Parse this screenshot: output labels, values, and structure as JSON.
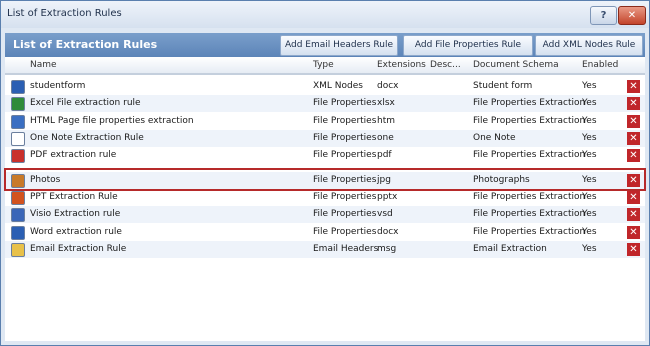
{
  "window": {
    "title": "List of Extraction Rules",
    "help_label": "?",
    "close_label": "✕"
  },
  "header": {
    "title": "List of Extraction Rules",
    "buttons": [
      "Add Email Headers Rule",
      "Add File Properties Rule",
      "Add XML Nodes Rule"
    ]
  },
  "columns": [
    "Name",
    "Type",
    "Extensions",
    "Desc...",
    "Document Schema",
    "Enabled"
  ],
  "rows": [
    {
      "name": "studentform",
      "type": "XML Nodes",
      "ext": "docx",
      "desc": "",
      "schema": "Student form",
      "enabled": "Yes",
      "icon": "word-icon"
    },
    {
      "name": "Excel File extraction rule",
      "type": "File Properties",
      "ext": "xlsx",
      "desc": "",
      "schema": "File Properties Extraction",
      "enabled": "Yes",
      "icon": "excel-icon"
    },
    {
      "name": "HTML Page file properties extraction",
      "type": "File Properties",
      "ext": "htm",
      "desc": "",
      "schema": "File Properties Extraction",
      "enabled": "Yes",
      "icon": "html-icon"
    },
    {
      "name": "One Note Extraction Rule",
      "type": "File Properties",
      "ext": "one",
      "desc": "",
      "schema": "One Note",
      "enabled": "Yes",
      "icon": "document-icon"
    },
    {
      "name": "PDF extraction rule",
      "type": "File Properties",
      "ext": "pdf",
      "desc": "",
      "schema": "File Properties Extraction",
      "enabled": "Yes",
      "icon": "pdf-icon"
    },
    {
      "name": "Photos",
      "type": "File Properties",
      "ext": "jpg",
      "desc": "",
      "schema": "Photographs",
      "enabled": "Yes",
      "icon": "image-icon"
    },
    {
      "name": "PPT Extraction Rule",
      "type": "File Properties",
      "ext": "pptx",
      "desc": "",
      "schema": "File Properties Extraction",
      "enabled": "Yes",
      "icon": "powerpoint-icon"
    },
    {
      "name": "Visio Extraction rule",
      "type": "File Properties",
      "ext": "vsd",
      "desc": "",
      "schema": "File Properties Extraction",
      "enabled": "Yes",
      "icon": "visio-icon"
    },
    {
      "name": "Word extraction rule",
      "type": "File Properties",
      "ext": "docx",
      "desc": "",
      "schema": "File Properties Extraction",
      "enabled": "Yes",
      "icon": "word-icon"
    },
    {
      "name": "Email Extraction Rule",
      "type": "Email Headers",
      "ext": "msg",
      "desc": "",
      "schema": "Email Extraction",
      "enabled": "Yes",
      "icon": "email-icon"
    }
  ],
  "delete_label": "✕",
  "icon_colors": {
    "word-icon": "#2b5fb3",
    "excel-icon": "#2e8b3a",
    "html-icon": "#3b6fc2",
    "document-icon": "#ffffff",
    "pdf-icon": "#c9302c",
    "image-icon": "#c87a2a",
    "powerpoint-icon": "#d2531f",
    "visio-icon": "#3a66b8",
    "email-icon": "#e8c14a"
  },
  "selected_row": "Photos"
}
